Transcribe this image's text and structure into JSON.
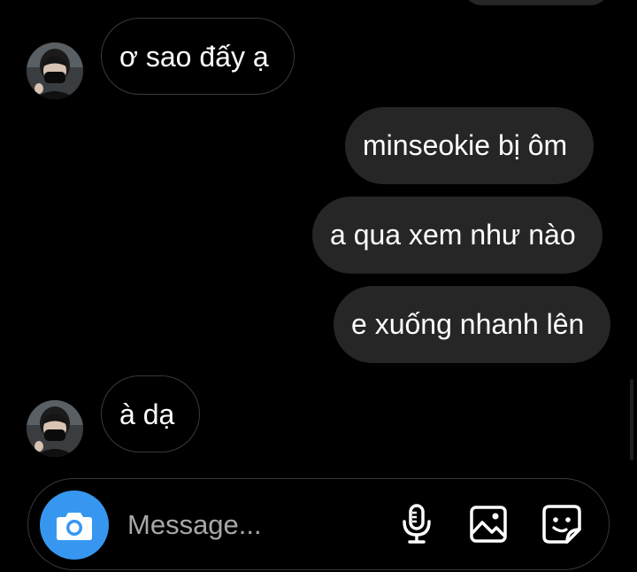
{
  "conversation": {
    "messages": [
      {
        "direction": "incoming",
        "text": "ơ sao đấy ạ",
        "avatar": "user-avatar-masked-person"
      },
      {
        "direction": "outgoing",
        "text": "minseokie bị ôm"
      },
      {
        "direction": "outgoing",
        "text": "a qua xem như nào"
      },
      {
        "direction": "outgoing",
        "text": "e xuống nhanh lên"
      },
      {
        "direction": "incoming",
        "text": "à dạ",
        "avatar": "user-avatar-masked-person"
      }
    ]
  },
  "composer": {
    "placeholder": "Message...",
    "value": "",
    "icons": {
      "camera": "camera-icon",
      "microphone": "microphone-icon",
      "gallery": "image-gallery-icon",
      "sticker": "sticker-icon"
    }
  },
  "colors": {
    "background": "#000000",
    "outgoing_bubble": "#262626",
    "incoming_border": "#3a3a3a",
    "text": "#ffffff",
    "placeholder": "#a8a8a8",
    "camera_button": "#3797f0"
  }
}
